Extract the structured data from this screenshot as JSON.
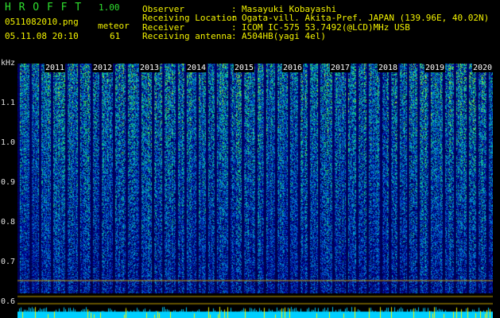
{
  "app": {
    "title": "H R O F F T",
    "version": "1.00"
  },
  "file": {
    "name": "0511082010.png",
    "datetime": "05.11.08 20:10"
  },
  "meteor": {
    "label": "meteor",
    "count": "61"
  },
  "station": {
    "rows": [
      {
        "key": "Observer",
        "sep": ":",
        "value": "Masayuki Kobayashi"
      },
      {
        "key": "Receiving Location",
        "sep": ":",
        "value": "Ogata-vill. Akita-Pref. JAPAN (139.96E, 40.02N)"
      },
      {
        "key": "Receiver",
        "sep": ":",
        "value": "ICOM IC-575 53.7492(@LCD)MHz USB"
      },
      {
        "key": "Receiving antenna",
        "sep": ":",
        "value": "A504HB(yagi 4el)"
      }
    ]
  },
  "axis": {
    "unit": "kHz",
    "ticks": [
      "1.1",
      "1.0",
      "0.9",
      "0.8",
      "0.7",
      "0.6"
    ],
    "years": [
      "2011",
      "2012",
      "2013",
      "2014",
      "2015",
      "2016",
      "2017",
      "2018",
      "2019",
      "2020"
    ]
  },
  "colors": {
    "title": "#2fe02f",
    "header": "#f2f200",
    "accent": "#00e0ff",
    "bg": "#000000"
  }
}
